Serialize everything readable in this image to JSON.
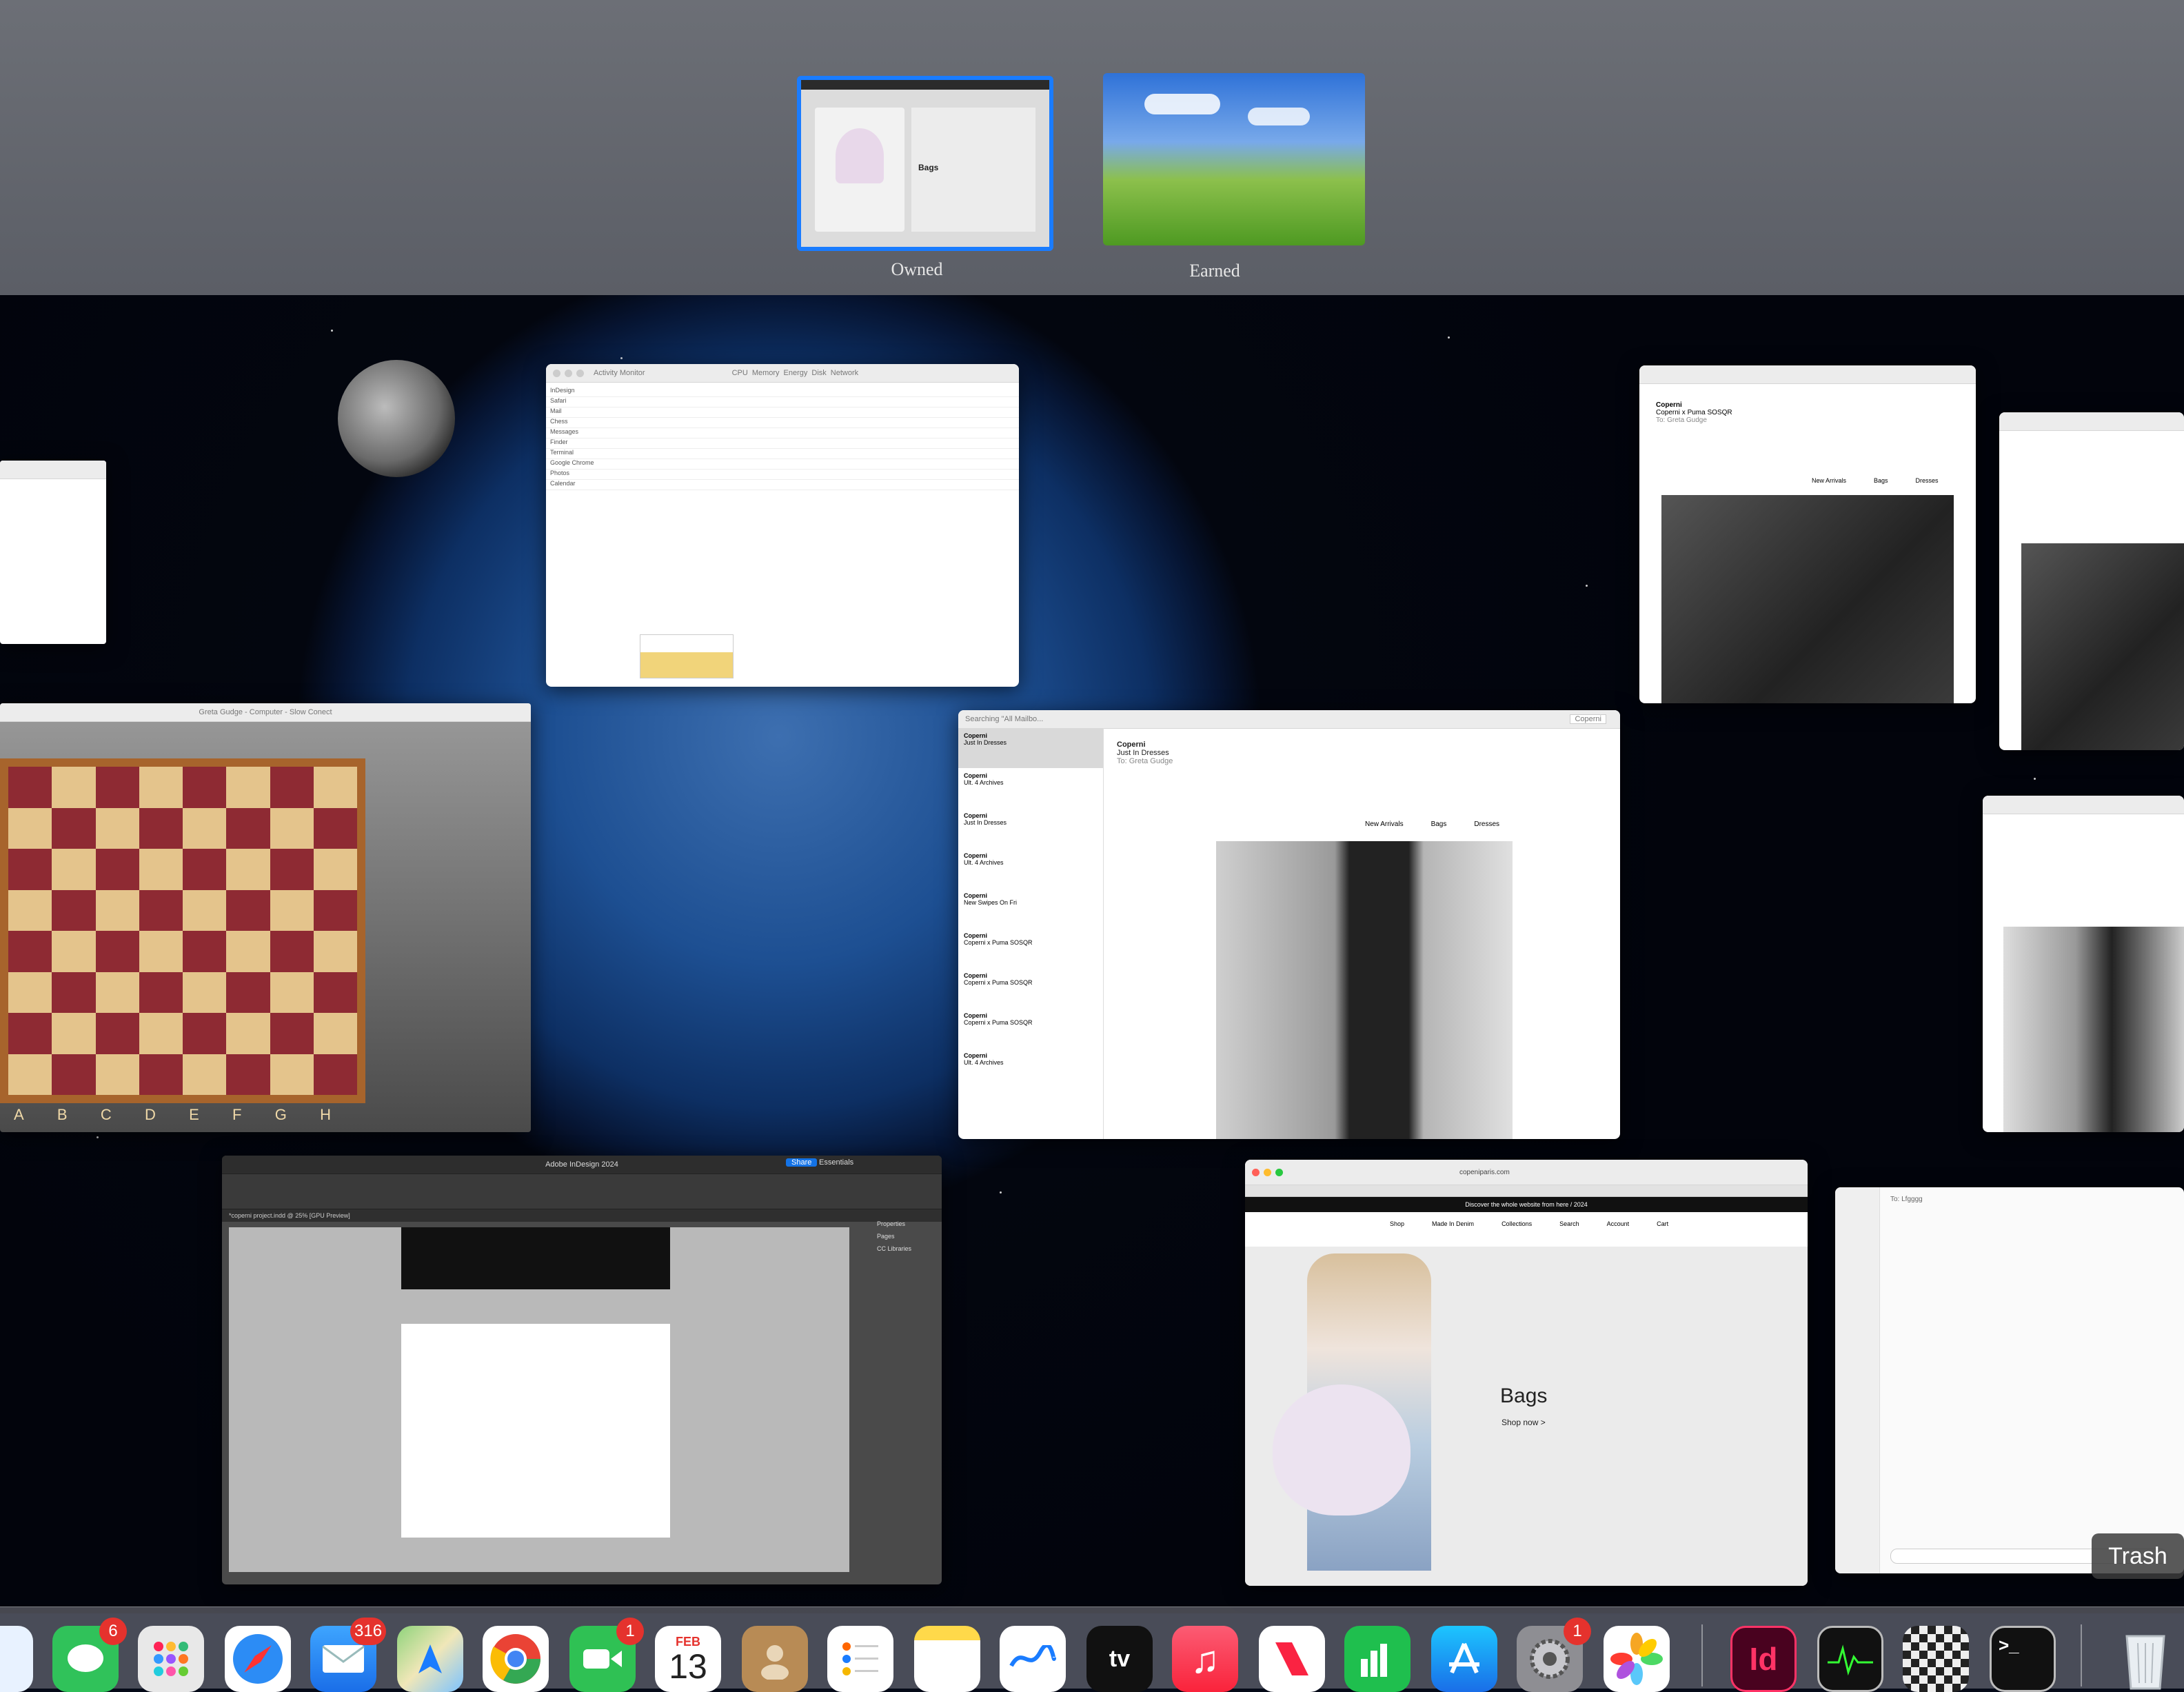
{
  "spaces": {
    "desktops": [
      {
        "label": "Owned",
        "selected": true
      },
      {
        "label": "Earned",
        "selected": false
      }
    ]
  },
  "windows": {
    "activity_monitor": {
      "title": "Activity Monitor",
      "tabs": [
        "CPU",
        "Memory",
        "Energy",
        "Disk",
        "Network"
      ],
      "rows": [
        "InDesign",
        "Safari",
        "Mail",
        "Chess",
        "Messages",
        "Finder",
        "Terminal",
        "Google Chrome",
        "Photos",
        "Calendar"
      ]
    },
    "mail_main": {
      "toolbar_title": "Searching \"All Mailbo...",
      "search_text": "Coperni",
      "sender": "Coperni",
      "subject": "Just In Dresses",
      "to": "To: Greta Gudge",
      "nav": [
        "New Arrivals",
        "Bags",
        "Dresses"
      ],
      "list_items": [
        {
          "from": "Coperni",
          "subject": "Just In Dresses"
        },
        {
          "from": "Coperni",
          "subject": "Ult. 4 Archives"
        },
        {
          "from": "Coperni",
          "subject": "Just In Dresses"
        },
        {
          "from": "Coperni",
          "subject": "Ult. 4 Archives"
        },
        {
          "from": "Coperni",
          "subject": "New Swipes On Fri"
        },
        {
          "from": "Coperni",
          "subject": "Coperni x Puma SOSQR"
        },
        {
          "from": "Coperni",
          "subject": "Coperni x Puma SOSQR"
        },
        {
          "from": "Coperni",
          "subject": "Coperni x Puma SOSQR"
        },
        {
          "from": "Coperni",
          "subject": "Ult. 4 Archives"
        }
      ]
    },
    "mail_right": {
      "sender": "Coperni",
      "subject": "Coperni x Puma SOSQR",
      "to": "To: Greta Gudge",
      "nav": [
        "New Arrivals",
        "Bags",
        "Dresses"
      ]
    },
    "chess": {
      "title": "Greta Gudge - Computer - Slow Conect",
      "files": [
        "A",
        "B",
        "C",
        "D",
        "E",
        "F",
        "G",
        "H"
      ]
    },
    "indesign": {
      "title": "Adobe InDesign 2024",
      "share_label": "Share",
      "workspace": "Essentials",
      "doc_tab": "*coperni project.indd @ 25% [GPU Preview]",
      "panels": [
        "Properties",
        "Pages",
        "CC Libraries"
      ]
    },
    "safari": {
      "url": "copeniparis.com",
      "banner": "Discover the whole website from here / 2024",
      "nav": [
        "Shop",
        "Made In Denim",
        "Collections",
        "Search",
        "Account",
        "Cart"
      ],
      "hero_title": "Bags",
      "hero_link": "Shop now >"
    },
    "messages": {
      "to": "To: Lfgggg"
    }
  },
  "dock": {
    "items": [
      {
        "name": "finder",
        "label": ""
      },
      {
        "name": "messages",
        "label": "",
        "badge": "6"
      },
      {
        "name": "launchpad",
        "label": ""
      },
      {
        "name": "safari",
        "label": ""
      },
      {
        "name": "mail",
        "label": "",
        "badge": "316"
      },
      {
        "name": "maps",
        "label": ""
      },
      {
        "name": "chrome",
        "label": ""
      },
      {
        "name": "facetime",
        "label": "",
        "badge": "1"
      },
      {
        "name": "calendar",
        "label": "13",
        "month": "FEB"
      },
      {
        "name": "contacts",
        "label": ""
      },
      {
        "name": "reminders",
        "label": ""
      },
      {
        "name": "notes",
        "label": ""
      },
      {
        "name": "freeform",
        "label": ""
      },
      {
        "name": "apple-tv",
        "label": "tv"
      },
      {
        "name": "music",
        "label": "♫"
      },
      {
        "name": "news",
        "label": ""
      },
      {
        "name": "numbers",
        "label": ""
      },
      {
        "name": "app-store",
        "label": ""
      },
      {
        "name": "system-settings",
        "label": "",
        "badge": "1"
      },
      {
        "name": "photos",
        "label": ""
      },
      {
        "name": "indesign",
        "label": "Id"
      },
      {
        "name": "activity-monitor",
        "label": ""
      },
      {
        "name": "chess",
        "label": ""
      },
      {
        "name": "terminal",
        "label": ">_"
      },
      {
        "name": "trash",
        "label": ""
      }
    ],
    "tooltip": "Trash"
  },
  "colors": {
    "selection_blue": "#1a7cff",
    "badge_red": "#e5322d"
  }
}
